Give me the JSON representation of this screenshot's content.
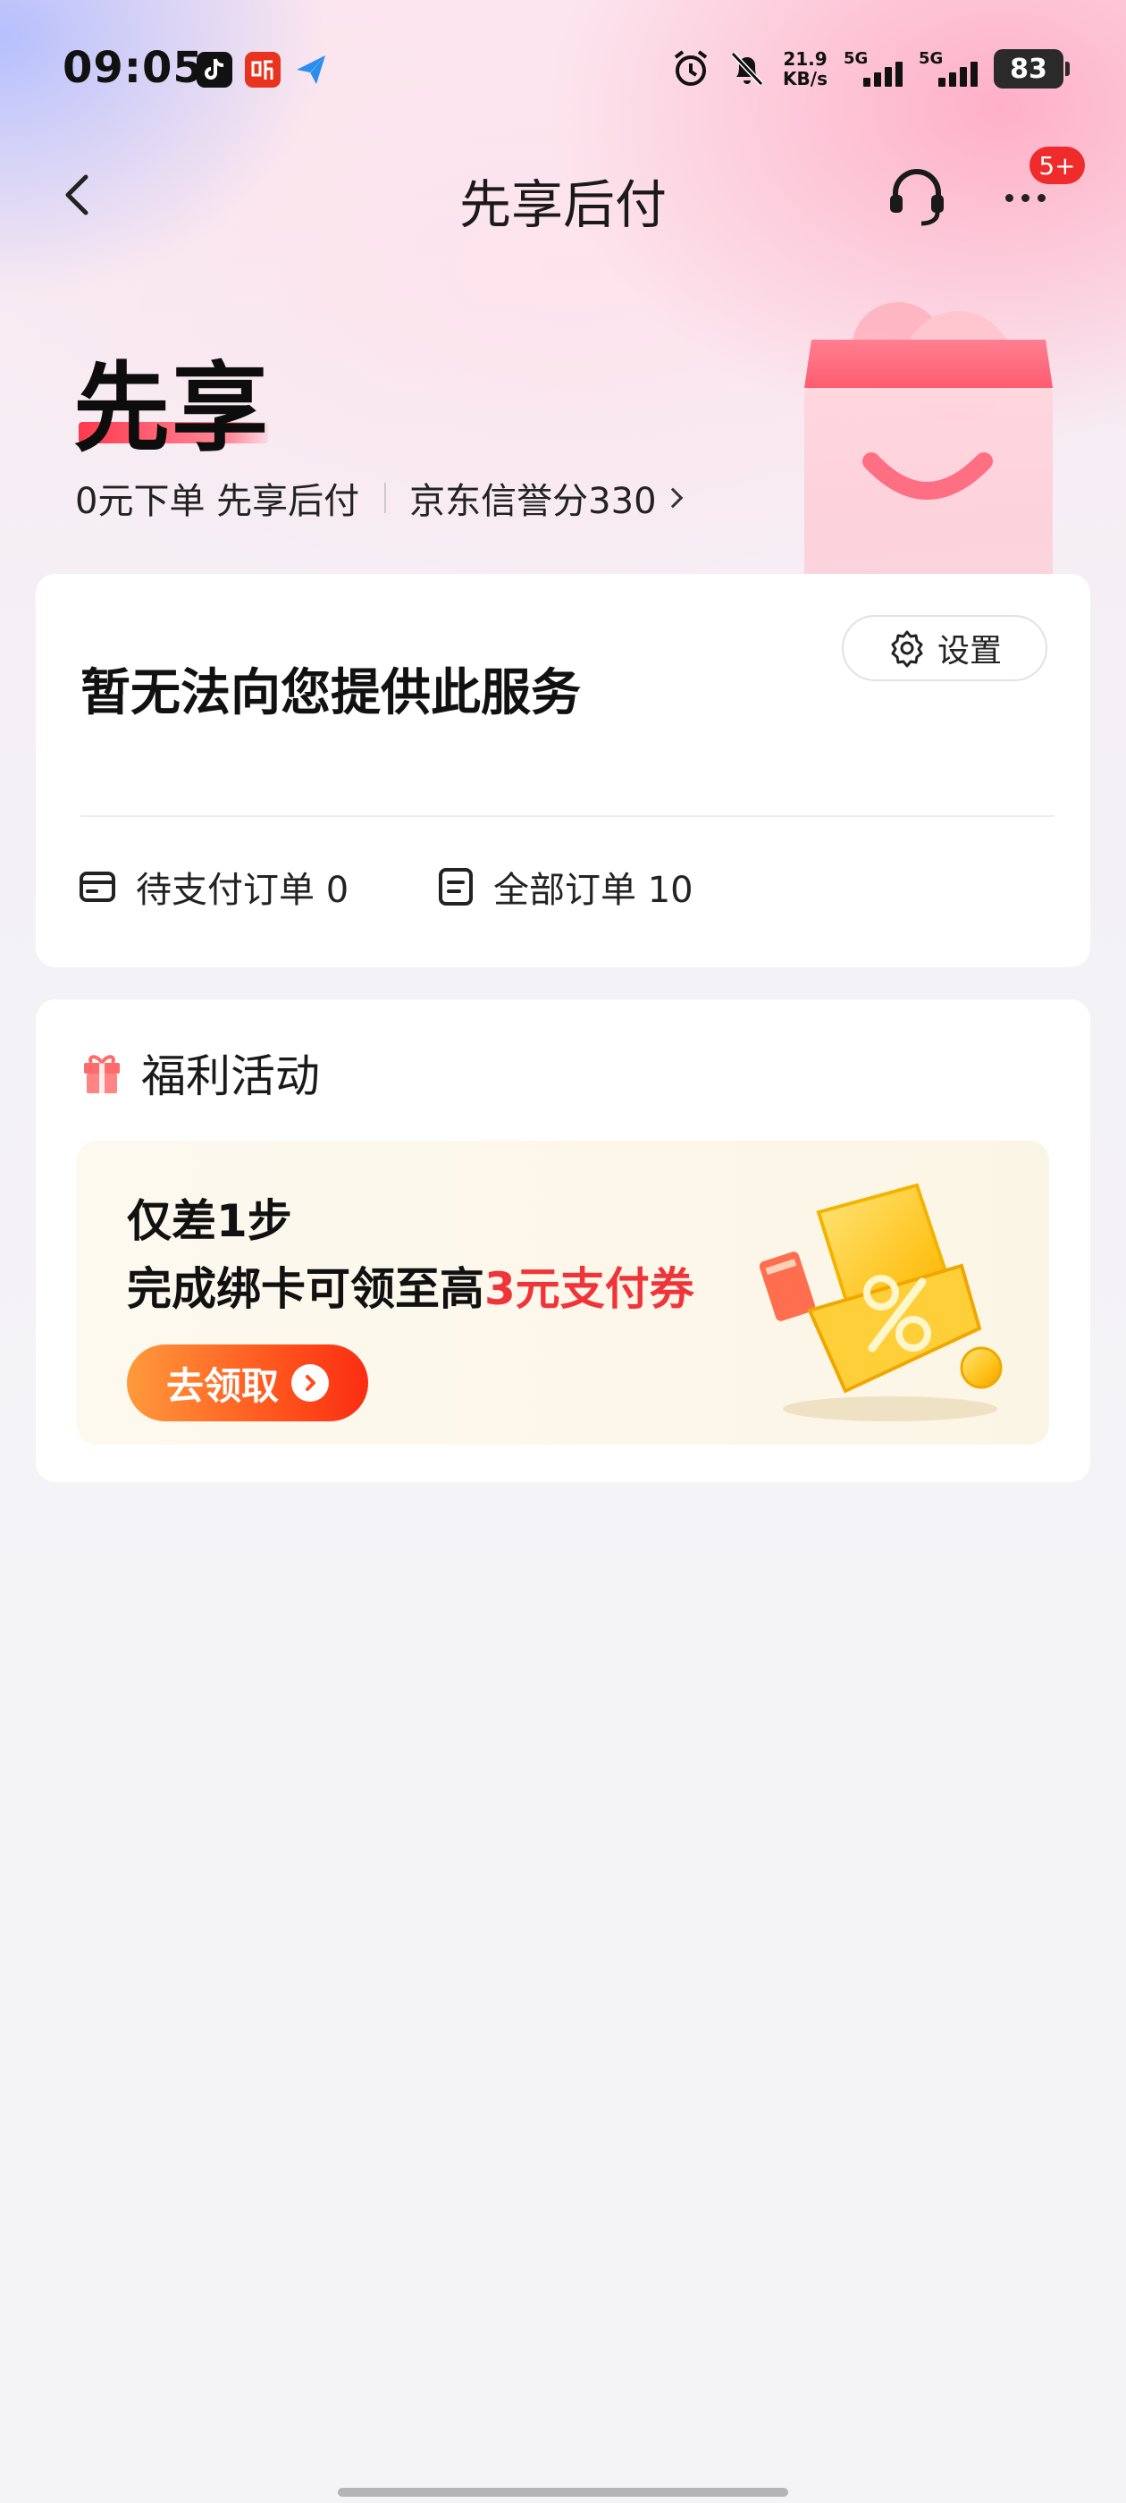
{
  "status_bar": {
    "time": "09:05",
    "app_icons": [
      "tiktok-icon",
      "ting-icon",
      "paper-plane-icon"
    ],
    "net_speed_value": "21.9",
    "net_speed_unit": "KB/s",
    "signal1_label": "5G",
    "signal2_label": "5G",
    "battery": "83"
  },
  "nav": {
    "title": "先享后付",
    "badge": "5+"
  },
  "hero": {
    "title": "先享",
    "subtitle_left": "0元下单 先享后付",
    "credit_score": "京东信誉分330"
  },
  "service_card": {
    "message": "暂无法向您提供此服务",
    "settings_label": "设置",
    "pending_orders": "待支付订单 0",
    "all_orders": "全部订单 10"
  },
  "welfare": {
    "heading": "福利活动",
    "promo_line1": "仅差1步",
    "promo_line2_prefix": "完成绑卡可领至高",
    "promo_line2_highlight": "3元支付券",
    "claim_label": "去领取"
  },
  "colors": {
    "accent_red": "#f0353a",
    "badge_red": "#ef2b2b",
    "button_orange": "#ff4c1a"
  }
}
